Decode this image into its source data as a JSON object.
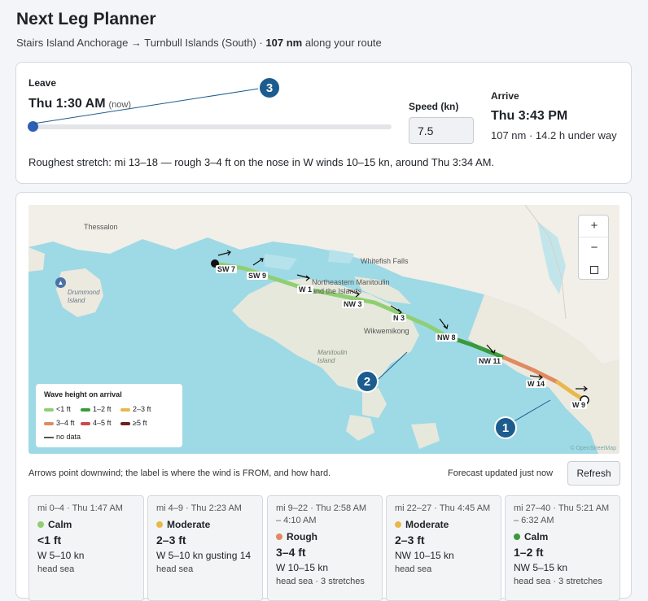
{
  "header": {
    "title": "Next Leg Planner",
    "route_text": "Stairs Island Anchorage → Turnbull Islands (South) · ",
    "distance": "107 nm",
    "route_suffix": " along your route"
  },
  "leave": {
    "label": "Leave",
    "time": "Thu 1:30 AM",
    "now_note": "(now)",
    "slider_fraction": 0.0
  },
  "speed": {
    "label": "Speed (kn)",
    "value": "7.5"
  },
  "arrive": {
    "label": "Arrive",
    "time": "Thu 3:43 PM",
    "detail": "107 nm · 14.2 h under way"
  },
  "roughest": "Roughest stretch: mi 13–18 — rough 3–4 ft on the nose in W winds 10–15 kn, around Thu 3:34 AM.",
  "map": {
    "place_labels": [
      "Thessalon",
      "Whitefish Falls",
      "Northeastern Manitoulin and the Islands",
      "Wikwemikong",
      "Manitoulin Island",
      "Drummond Island"
    ],
    "wind_labels": [
      "SW 7",
      "SW 9",
      "W 1",
      "NW 3",
      "N 3",
      "NW 8",
      "NW 11",
      "W 14",
      "W 9"
    ],
    "zoom": {
      "in": "+",
      "out": "−"
    },
    "copyright": "© OpenStreetMap",
    "legend": {
      "title": "Wave height on arrival",
      "items": [
        {
          "label": "<1 ft",
          "color": "#8fcf72"
        },
        {
          "label": "1–2 ft",
          "color": "#3a9a3a"
        },
        {
          "label": "2–3 ft",
          "color": "#e9b84a"
        },
        {
          "label": "3–4 ft",
          "color": "#e08a62"
        },
        {
          "label": "4–5 ft",
          "color": "#cc4a4a"
        },
        {
          "label": "≥5 ft",
          "color": "#6e1e1e"
        }
      ],
      "no_data": "no data"
    }
  },
  "hint": "Arrows point downwind; the label is where the wind is FROM, and how hard.",
  "forecast_updated": "Forecast updated just now",
  "refresh_label": "Refresh",
  "segments": [
    {
      "head": "mi 0–4 · Thu 1:47 AM",
      "severity": "Calm",
      "color": "#8fcf72",
      "height": "<1 ft",
      "wind": "W 5–10 kn",
      "sea": "head sea"
    },
    {
      "head": "mi 4–9 · Thu 2:23 AM",
      "severity": "Moderate",
      "color": "#e9b84a",
      "height": "2–3 ft",
      "wind": "W 5–10 kn gusting 14",
      "sea": "head sea"
    },
    {
      "head": "mi 9–22 · Thu 2:58 AM – 4:10 AM",
      "severity": "Rough",
      "color": "#e08a62",
      "height": "3–4 ft",
      "wind": "W 10–15 kn",
      "sea": "head sea · 3 stretches"
    },
    {
      "head": "mi 22–27 · Thu 4:45 AM",
      "severity": "Moderate",
      "color": "#e9b84a",
      "height": "2–3 ft",
      "wind": "NW 10–15 kn",
      "sea": "head sea"
    },
    {
      "head": "mi 27–40 · Thu 5:21 AM – 6:32 AM",
      "severity": "Calm",
      "color": "#3a9a3a",
      "height": "1–2 ft",
      "wind": "NW 5–15 kn",
      "sea": "head sea · 3 stretches"
    }
  ],
  "badges": [
    "1",
    "2",
    "3"
  ]
}
